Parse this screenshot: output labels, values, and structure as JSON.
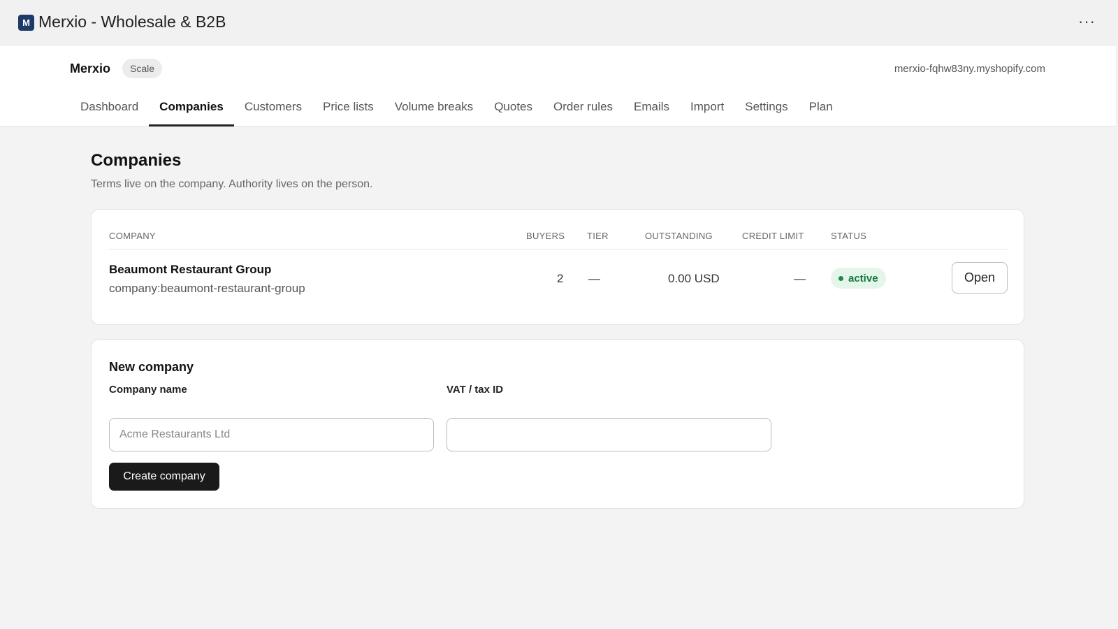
{
  "app": {
    "logo_letter": "M",
    "title": "Merxio - Wholesale & B2B",
    "more_label": "···"
  },
  "header": {
    "shop_name": "Merxio",
    "plan": "Scale",
    "domain": "merxio-fqhw83ny.myshopify.com"
  },
  "tabs": [
    {
      "label": "Dashboard",
      "active": false
    },
    {
      "label": "Companies",
      "active": true
    },
    {
      "label": "Customers",
      "active": false
    },
    {
      "label": "Price lists",
      "active": false
    },
    {
      "label": "Volume breaks",
      "active": false
    },
    {
      "label": "Quotes",
      "active": false
    },
    {
      "label": "Order rules",
      "active": false
    },
    {
      "label": "Emails",
      "active": false
    },
    {
      "label": "Import",
      "active": false
    },
    {
      "label": "Settings",
      "active": false
    },
    {
      "label": "Plan",
      "active": false
    }
  ],
  "page": {
    "title": "Companies",
    "subtitle": "Terms live on the company. Authority lives on the person."
  },
  "table": {
    "headers": {
      "company": "COMPANY",
      "buyers": "BUYERS",
      "tier": "TIER",
      "outstanding": "OUTSTANDING",
      "credit_limit": "CREDIT LIMIT",
      "status": "STATUS"
    },
    "rows": [
      {
        "name": "Beaumont Restaurant Group",
        "handle": "company:beaumont-restaurant-group",
        "buyers": "2",
        "tier": "—",
        "outstanding": "0.00 USD",
        "credit_limit": "—",
        "status": "active",
        "action": "Open"
      }
    ]
  },
  "form": {
    "title": "New company",
    "company_name_label": "Company name",
    "company_name_placeholder": "Acme Restaurants Ltd",
    "company_name_value": "",
    "vat_label": "VAT / tax ID",
    "vat_placeholder": "",
    "vat_value": "",
    "submit_label": "Create company"
  },
  "colors": {
    "status_active_bg": "#e4f5ea",
    "status_active_text": "#137a3c",
    "primary_button": "#1a1a1a",
    "logo_bg": "#1e3a66"
  }
}
